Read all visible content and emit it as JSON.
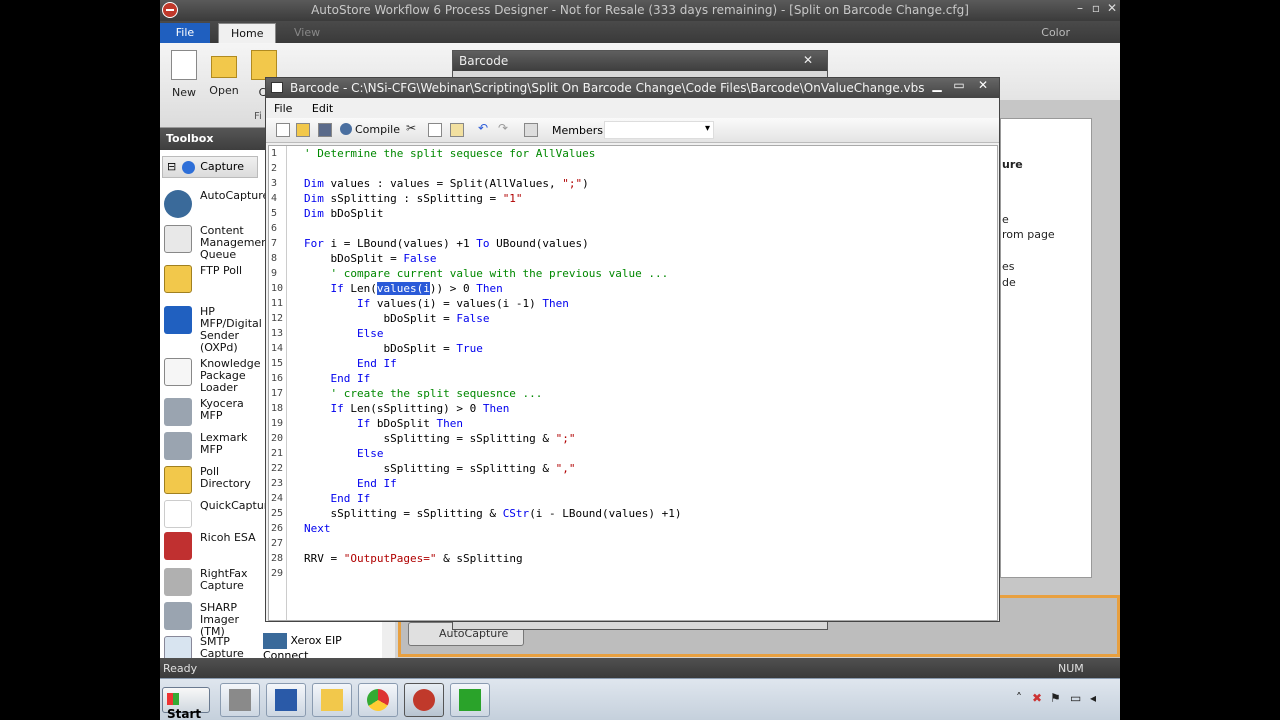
{
  "app": {
    "title": "AutoStore Workflow 6 Process Designer - Not for Resale (333 days remaining) - [Split on Barcode Change.cfg]",
    "color_label": "Color",
    "minimize": "–",
    "restore": "▫",
    "close": "✕"
  },
  "ribbon": {
    "tabs": [
      "File",
      "Home",
      "View"
    ],
    "buttons": {
      "new": "New",
      "open": "Open",
      "close": "Cl"
    },
    "group_label": "Fi"
  },
  "toolbox": {
    "title": "Toolbox",
    "group": "Capture",
    "expander": "⊟",
    "items": [
      {
        "label": "AutoCapture"
      },
      {
        "label": "Content Management Queue"
      },
      {
        "label": "FTP Poll"
      },
      {
        "label": "HP MFP/Digital Sender (OXPd)"
      },
      {
        "label": "Knowledge Package Loader"
      },
      {
        "label": "Kyocera MFP"
      },
      {
        "label": "Lexmark MFP"
      },
      {
        "label": "Poll Directory"
      },
      {
        "label": "QuickCapture"
      },
      {
        "label": "Ricoh ESA"
      },
      {
        "label": "RightFax Capture"
      },
      {
        "label": "SHARP Imager (TM)"
      },
      {
        "label": "SMTP Capture"
      }
    ],
    "xerox": "Xerox EIP Connect"
  },
  "background": {
    "panel_texts": [
      "ure",
      "e",
      "rom page",
      "es",
      "de"
    ],
    "autocapture_node": "AutoCapture"
  },
  "barcode_dialog": {
    "title": "Barcode",
    "close": "✕"
  },
  "editor": {
    "title": "Barcode - C:\\NSi-CFG\\Webinar\\Scripting\\Split On Barcode Change\\Code Files\\Barcode\\OnValueChange.vbs",
    "menu": [
      "File",
      "Edit"
    ],
    "compile": "Compile",
    "members_label": "Members:",
    "members_value": "",
    "minimize": "▁",
    "maximize": "▭",
    "close": "✕",
    "lines": [
      [
        {
          "c": "cm",
          "t": "' Determine the split sequesce for AllValues"
        }
      ],
      [],
      [
        {
          "c": "kw",
          "t": "Dim"
        },
        {
          "t": " values : values = Split(AllValues, "
        },
        {
          "c": "st",
          "t": "\";\""
        },
        {
          "t": ")"
        }
      ],
      [
        {
          "c": "kw",
          "t": "Dim"
        },
        {
          "t": " sSplitting : sSplitting = "
        },
        {
          "c": "st",
          "t": "\"1\""
        }
      ],
      [
        {
          "c": "kw",
          "t": "Dim"
        },
        {
          "t": " bDoSplit"
        }
      ],
      [],
      [
        {
          "c": "kw",
          "t": "For"
        },
        {
          "t": " i = LBound(values) +1 "
        },
        {
          "c": "kw",
          "t": "To"
        },
        {
          "t": " UBound(values)"
        }
      ],
      [
        {
          "t": "    bDoSplit = "
        },
        {
          "c": "kw",
          "t": "False"
        }
      ],
      [
        {
          "t": "    "
        },
        {
          "c": "cm",
          "t": "' compare current value with the previous value ..."
        }
      ],
      [
        {
          "t": "    "
        },
        {
          "c": "kw",
          "t": "If"
        },
        {
          "t": " Len("
        },
        {
          "c": "sel",
          "t": "values(i"
        },
        {
          "t": ")) > 0 "
        },
        {
          "c": "kw",
          "t": "Then"
        }
      ],
      [
        {
          "t": "        "
        },
        {
          "c": "kw",
          "t": "If"
        },
        {
          "t": " values(i) = values(i -1) "
        },
        {
          "c": "kw",
          "t": "Then"
        }
      ],
      [
        {
          "t": "            bDoSplit = "
        },
        {
          "c": "kw",
          "t": "False"
        }
      ],
      [
        {
          "t": "        "
        },
        {
          "c": "kw",
          "t": "Else"
        }
      ],
      [
        {
          "t": "            bDoSplit = "
        },
        {
          "c": "kw",
          "t": "True"
        }
      ],
      [
        {
          "t": "        "
        },
        {
          "c": "kw",
          "t": "End If"
        }
      ],
      [
        {
          "t": "    "
        },
        {
          "c": "kw",
          "t": "End If"
        }
      ],
      [
        {
          "t": "    "
        },
        {
          "c": "cm",
          "t": "' create the split sequesnce ..."
        }
      ],
      [
        {
          "t": "    "
        },
        {
          "c": "kw",
          "t": "If"
        },
        {
          "t": " Len(sSplitting) > 0 "
        },
        {
          "c": "kw",
          "t": "Then"
        }
      ],
      [
        {
          "t": "        "
        },
        {
          "c": "kw",
          "t": "If"
        },
        {
          "t": " bDoSplit "
        },
        {
          "c": "kw",
          "t": "Then"
        }
      ],
      [
        {
          "t": "            sSplitting = sSplitting & "
        },
        {
          "c": "st",
          "t": "\";\""
        }
      ],
      [
        {
          "t": "        "
        },
        {
          "c": "kw",
          "t": "Else"
        }
      ],
      [
        {
          "t": "            sSplitting = sSplitting & "
        },
        {
          "c": "st",
          "t": "\",\""
        }
      ],
      [
        {
          "t": "        "
        },
        {
          "c": "kw",
          "t": "End If"
        }
      ],
      [
        {
          "t": "    "
        },
        {
          "c": "kw",
          "t": "End If"
        }
      ],
      [
        {
          "t": "    sSplitting = sSplitting & "
        },
        {
          "c": "kw",
          "t": "CStr"
        },
        {
          "t": "(i - LBound(values) +1)"
        }
      ],
      [
        {
          "c": "kw",
          "t": "Next"
        }
      ],
      [],
      [
        {
          "t": "RRV = "
        },
        {
          "c": "st",
          "t": "\"OutputPages=\""
        },
        {
          "t": " & sSplitting"
        }
      ],
      []
    ]
  },
  "status": {
    "ready": "Ready",
    "num": "NUM"
  },
  "taskbar": {
    "start": "Start"
  }
}
